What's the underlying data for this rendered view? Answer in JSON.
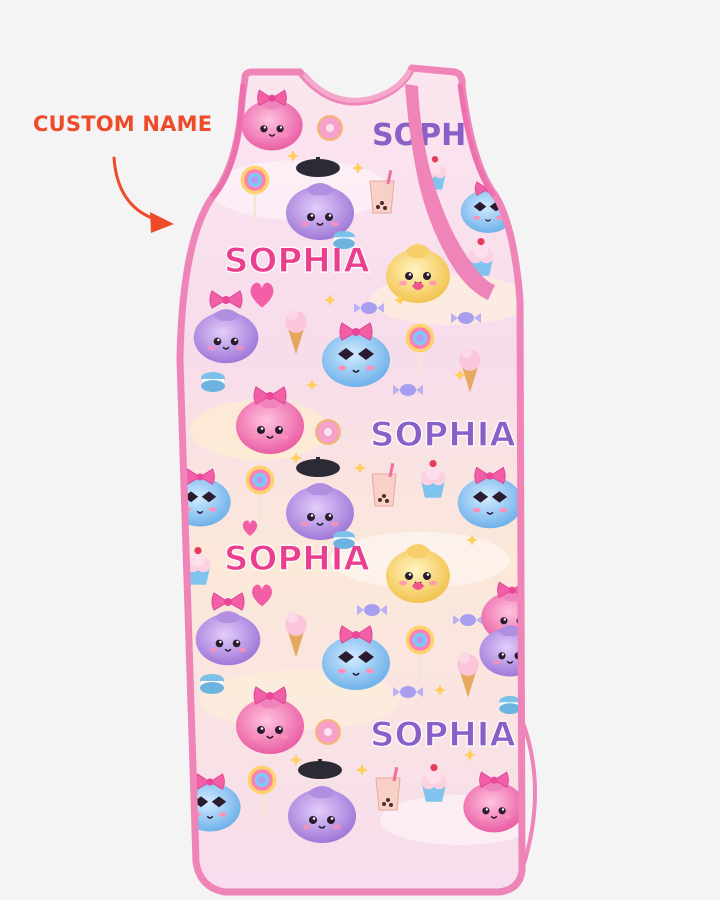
{
  "callout": {
    "label": "CUSTOM NAME",
    "color": "#ee4b2b"
  },
  "product": {
    "type": "sleeveless baby sleep sack",
    "trim_color": "#ef84b8",
    "fabric_base_color": "#f9e3ee",
    "pattern": "kawaii candy dumplings, lollipops, ice cream, bubble tea, donuts, macarons, cupcakes",
    "name_print": "SOPHIA",
    "name_colors": [
      "#ea3f8f",
      "#8a5fc7"
    ]
  }
}
